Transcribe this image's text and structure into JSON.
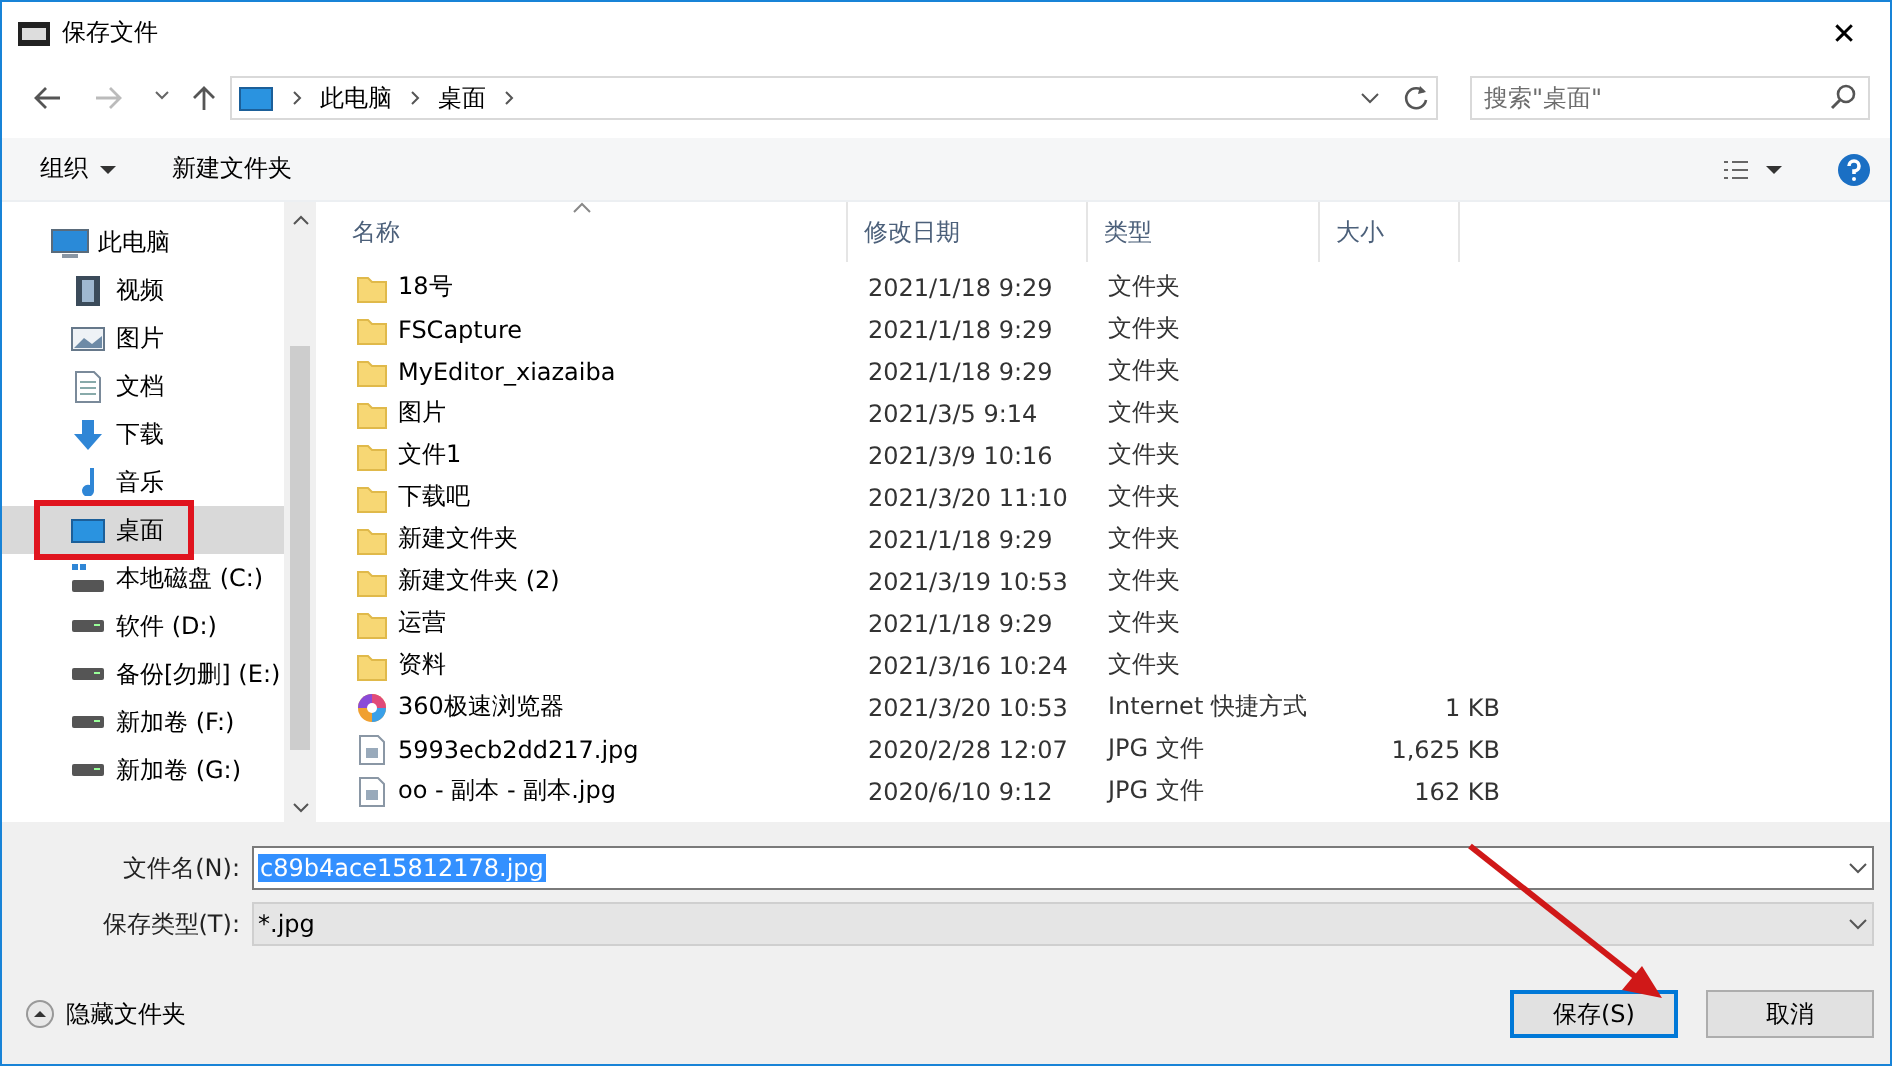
{
  "window": {
    "title": "保存文件",
    "close": "✕"
  },
  "address": {
    "path": [
      {
        "label": "此电脑"
      },
      {
        "label": "桌面"
      }
    ],
    "search_placeholder": "搜索\"桌面\""
  },
  "toolbar": {
    "organize": "组织",
    "new_folder": "新建文件夹"
  },
  "sidebar": {
    "items": [
      {
        "label": "此电脑",
        "kind": "pc",
        "selected": false,
        "highlighted": false,
        "children": [
          {
            "label": "视频",
            "kind": "video",
            "selected": false,
            "highlighted": false
          },
          {
            "label": "图片",
            "kind": "pictures",
            "selected": false,
            "highlighted": false
          },
          {
            "label": "文档",
            "kind": "documents",
            "selected": false,
            "highlighted": false
          },
          {
            "label": "下载",
            "kind": "downloads",
            "selected": false,
            "highlighted": false
          },
          {
            "label": "音乐",
            "kind": "music",
            "selected": false,
            "highlighted": false
          },
          {
            "label": "桌面",
            "kind": "desktop",
            "selected": true,
            "highlighted": true
          },
          {
            "label": "本地磁盘 (C:)",
            "kind": "system-drive",
            "selected": false,
            "highlighted": false
          },
          {
            "label": "软件 (D:)",
            "kind": "drive",
            "selected": false,
            "highlighted": false
          },
          {
            "label": "备份[勿删] (E:)",
            "kind": "drive",
            "selected": false,
            "highlighted": false
          },
          {
            "label": "新加卷 (F:)",
            "kind": "drive",
            "selected": false,
            "highlighted": false
          },
          {
            "label": "新加卷 (G:)",
            "kind": "drive",
            "selected": false,
            "highlighted": false
          }
        ]
      }
    ]
  },
  "table": {
    "columns": [
      {
        "label": "名称",
        "sorted": true
      },
      {
        "label": "修改日期",
        "sorted": false
      },
      {
        "label": "类型",
        "sorted": false
      },
      {
        "label": "大小",
        "sorted": false
      }
    ],
    "rows": [
      {
        "kind": "folder",
        "name": "18号",
        "date": "2021/1/18 9:29",
        "type": "文件夹",
        "size": ""
      },
      {
        "kind": "folder",
        "name": "FSCapture",
        "date": "2021/1/18 9:29",
        "type": "文件夹",
        "size": ""
      },
      {
        "kind": "folder",
        "name": "MyEditor_xiazaiba",
        "date": "2021/1/18 9:29",
        "type": "文件夹",
        "size": ""
      },
      {
        "kind": "folder",
        "name": "图片",
        "date": "2021/3/5 9:14",
        "type": "文件夹",
        "size": ""
      },
      {
        "kind": "folder",
        "name": "文件1",
        "date": "2021/3/9 10:16",
        "type": "文件夹",
        "size": ""
      },
      {
        "kind": "folder",
        "name": "下载吧",
        "date": "2021/3/20 11:10",
        "type": "文件夹",
        "size": ""
      },
      {
        "kind": "folder",
        "name": "新建文件夹",
        "date": "2021/1/18 9:29",
        "type": "文件夹",
        "size": ""
      },
      {
        "kind": "folder",
        "name": "新建文件夹 (2)",
        "date": "2021/3/19 10:53",
        "type": "文件夹",
        "size": ""
      },
      {
        "kind": "folder",
        "name": "运营",
        "date": "2021/1/18 9:29",
        "type": "文件夹",
        "size": ""
      },
      {
        "kind": "folder",
        "name": "资料",
        "date": "2021/3/16 10:24",
        "type": "文件夹",
        "size": ""
      },
      {
        "kind": "shortcut",
        "name": "360极速浏览器",
        "date": "2021/3/20 10:53",
        "type": "Internet 快捷方式",
        "size": "1 KB"
      },
      {
        "kind": "image",
        "name": "5993ecb2dd217.jpg",
        "date": "2020/2/28 12:07",
        "type": "JPG 文件",
        "size": "1,625 KB"
      },
      {
        "kind": "image",
        "name": "oo - 副本 - 副本.jpg",
        "date": "2020/6/10 9:12",
        "type": "JPG 文件",
        "size": "162 KB"
      }
    ]
  },
  "form": {
    "filename_label": "文件名(N):",
    "filename": "c89b4ace15812178.jpg",
    "filetype_label": "保存类型(T):",
    "filetype": "*.jpg"
  },
  "footer": {
    "hide_folders": "隐藏文件夹",
    "save": "保存(S)",
    "save_arrow": true,
    "cancel": "取消"
  }
}
